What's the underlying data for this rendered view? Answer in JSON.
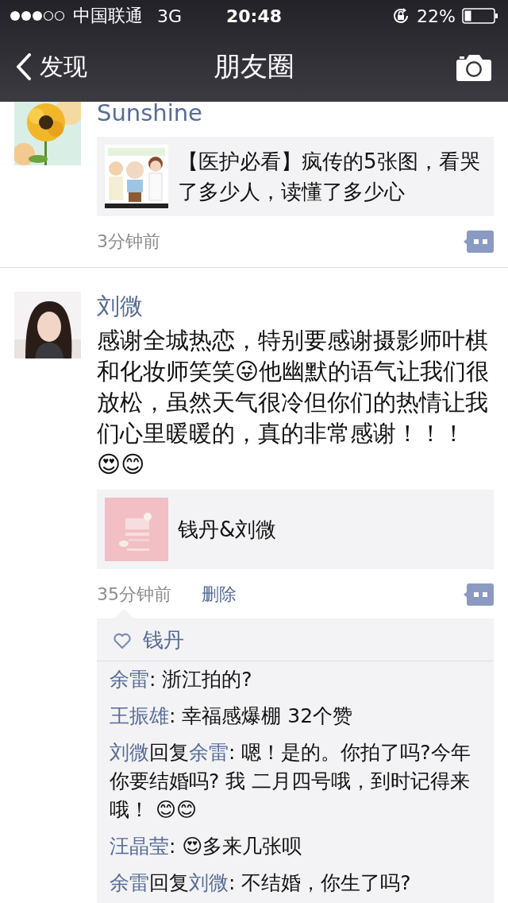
{
  "status_bar": {
    "carrier": "中国联通",
    "network": "3G",
    "time": "20:48",
    "battery": "22%"
  },
  "nav": {
    "back": "发现",
    "title": "朋友圈"
  },
  "posts": [
    {
      "author": "Sunshine",
      "link": {
        "title": "【医护必看】疯传的5张图，看哭了多少人，读懂了多少心"
      },
      "time": "3分钟前"
    },
    {
      "author": "刘微",
      "text": "感谢全城热恋，特别要感谢摄影师叶棋和化妆师笑笑😜他幽默的语气让我们很放松，虽然天气很冷但你们的热情让我们心里暖暖的，真的非常感谢！！！ 😍😊",
      "link": {
        "title": "钱丹&刘微"
      },
      "time": "35分钟前",
      "delete": "删除",
      "likes": [
        "钱丹"
      ],
      "comments": [
        {
          "author": "余雷",
          "text": ": 浙江拍的?"
        },
        {
          "author": "王振雄",
          "text": ": 幸福感爆棚 32个赞"
        },
        {
          "author": "刘微",
          "reply_word": "回复",
          "reply_to": "余雷",
          "text": ": 嗯！是的。你拍了吗?今年你要结婚吗? 我 二月四号哦，到时记得来哦！ 😊😊"
        },
        {
          "author": "汪晶莹",
          "text": ": 😍多来几张呗"
        },
        {
          "author": "余雷",
          "reply_word": "回复",
          "reply_to": "刘微",
          "text": ": 不结婚，你生了吗?"
        }
      ]
    }
  ]
}
